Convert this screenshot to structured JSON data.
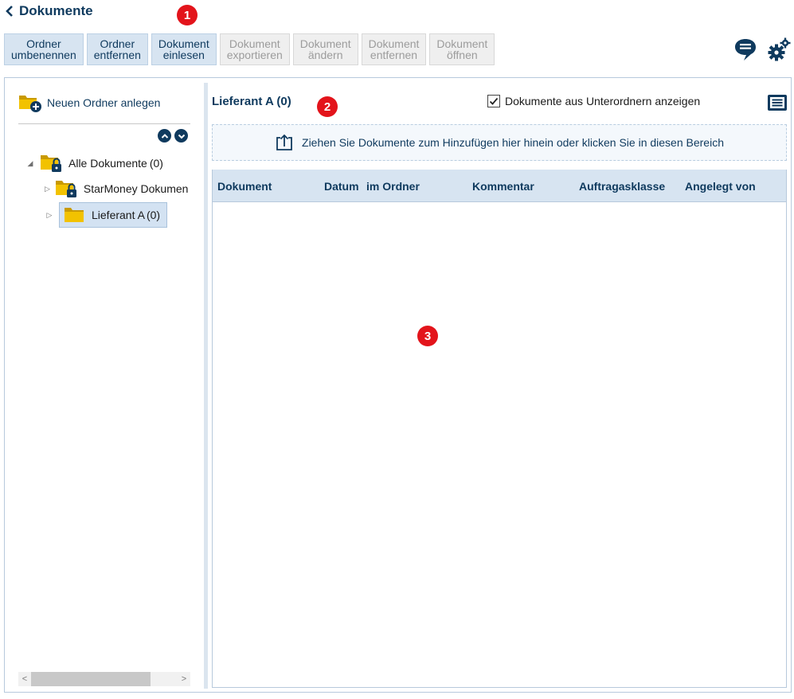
{
  "header": {
    "back_label": "Dokumente"
  },
  "markers": [
    "1",
    "2",
    "3"
  ],
  "toolbar": {
    "buttons": [
      {
        "line1": "Ordner",
        "line2": "umbenennen",
        "enabled": true
      },
      {
        "line1": "Ordner",
        "line2": "entfernen",
        "enabled": true
      },
      {
        "line1": "Dokument",
        "line2": "einlesen",
        "enabled": true
      },
      {
        "line1": "Dokument",
        "line2": "exportieren",
        "enabled": false
      },
      {
        "line1": "Dokument",
        "line2": "ändern",
        "enabled": false
      },
      {
        "line1": "Dokument",
        "line2": "entfernen",
        "enabled": false
      },
      {
        "line1": "Dokument",
        "line2": "öffnen",
        "enabled": false
      }
    ],
    "icons": [
      "chat-icon",
      "settings-gears-icon"
    ]
  },
  "left": {
    "new_folder_label": "Neuen Ordner anlegen",
    "tree": {
      "root": {
        "label": "Alle Dokumente",
        "count": "(0)",
        "expanded": true
      },
      "children": [
        {
          "label": "StarMoney Dokumente",
          "count": "",
          "locked": true
        },
        {
          "label": "Lieferant A",
          "count": "(0)",
          "selected": true
        }
      ]
    }
  },
  "right": {
    "title": "Lieferant A (0)",
    "show_subfolders_label": "Dokumente aus Unterordnern anzeigen",
    "show_subfolders_checked": true,
    "dropzone_text": "Ziehen Sie Dokumente zum Hinzufügen hier hinein oder klicken Sie in diesen Bereich",
    "columns": [
      "Dokument",
      "Datum",
      "im Ordner",
      "Kommentar",
      "Auftragasklasse",
      "Angelegt von"
    ],
    "rows": []
  },
  "colors": {
    "primary": "#0f3a5e",
    "button_bg": "#d7e4f1",
    "marker": "#e3141b",
    "folder": "#f2c200"
  }
}
